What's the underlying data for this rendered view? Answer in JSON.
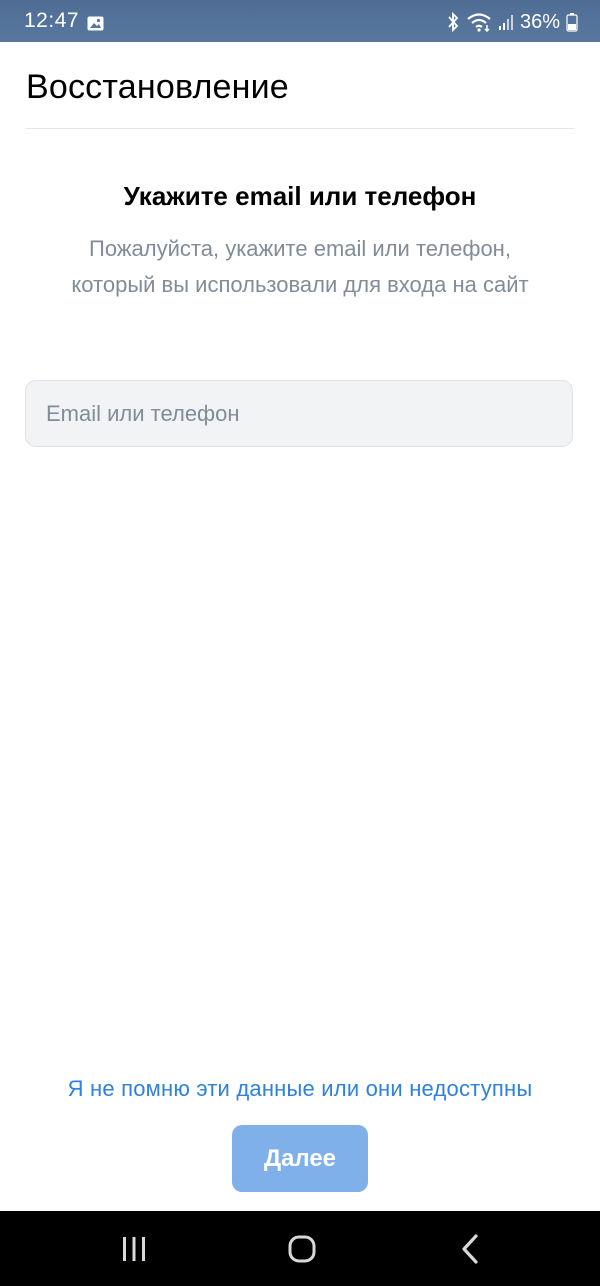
{
  "status_bar": {
    "time": "12:47",
    "battery": "36%",
    "icons": [
      "gallery-icon",
      "bluetooth-icon",
      "wifi-icon",
      "signal-icon",
      "battery-icon"
    ]
  },
  "header": {
    "title": "Восстановление"
  },
  "main": {
    "heading": "Укажите email или телефон",
    "subtitle": "Пожалуйста, укажите email или телефон, который вы использовали для входа на сайт",
    "input": {
      "placeholder": "Email или телефон",
      "value": ""
    }
  },
  "footer": {
    "link": "Я не помню эти данные или они недоступны",
    "next_button": "Далее"
  },
  "nav": {
    "icons": [
      "recent-apps-icon",
      "home-icon",
      "back-icon"
    ]
  },
  "colors": {
    "status_bar": "#5675a0",
    "link": "#2d81e0",
    "button_disabled": "#7fb0ea",
    "subtitle": "#818c99",
    "input_bg": "#f2f3f5"
  }
}
